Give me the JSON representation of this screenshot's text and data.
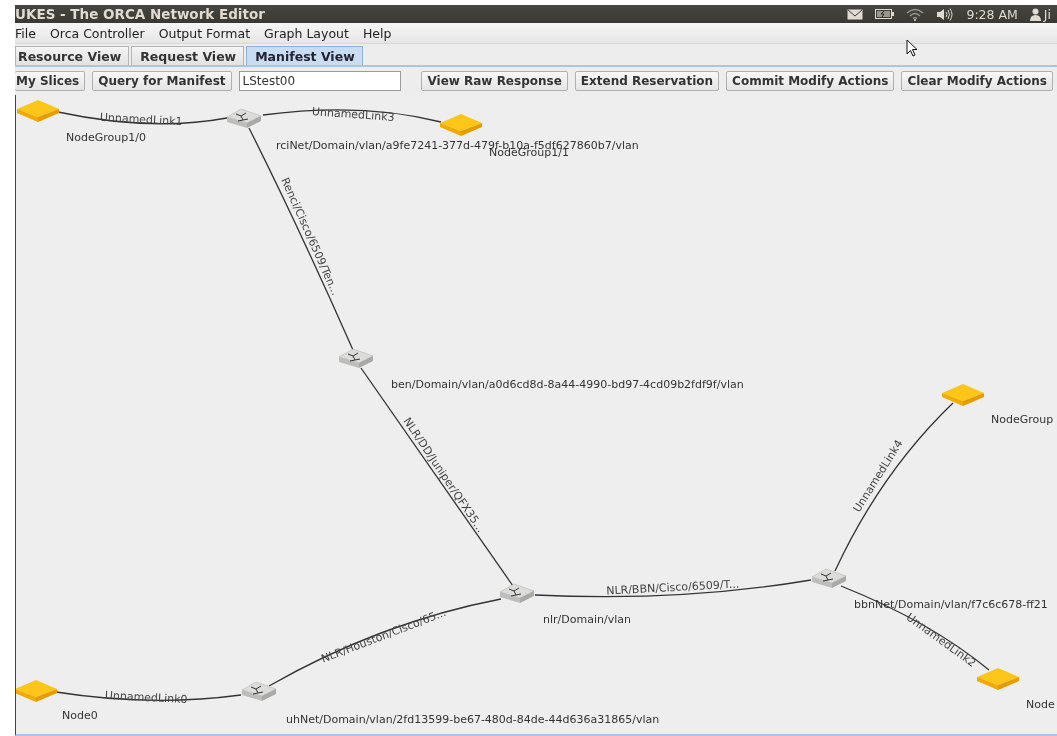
{
  "window": {
    "title": "UKES - The ORCA Network Editor"
  },
  "tray": {
    "clock": "9:28 AM",
    "user": "Ji"
  },
  "menu": [
    "File",
    "Orca Controller",
    "Output Format",
    "Graph Layout",
    "Help"
  ],
  "tabs": [
    {
      "label": "Resource View",
      "selected": false
    },
    {
      "label": "Request View",
      "selected": false
    },
    {
      "label": "Manifest View",
      "selected": true
    }
  ],
  "toolbar": {
    "left_buttons": [
      "My Slices",
      "Query for Manifest"
    ],
    "slice_field": {
      "value": "LStest00"
    },
    "right_buttons": [
      "View Raw Response",
      "Extend Reservation",
      "Commit Modify Actions",
      "Clear Modify Actions"
    ]
  },
  "graph": {
    "nodes": [
      {
        "kind": "compute",
        "label": "NodeGroup1/0"
      },
      {
        "kind": "switch",
        "label": "rciNet/Domain/vlan/a9fe7241-377d-479f-b10a-f5df627860b7/vlan"
      },
      {
        "kind": "compute",
        "label": "NodeGroup1/1"
      },
      {
        "kind": "switch",
        "label": "ben/Domain/vlan/a0d6cd8d-8a44-4990-bd97-4cd09b2fdf9f/vlan"
      },
      {
        "kind": "compute",
        "label": "NodeGroup"
      },
      {
        "kind": "switch",
        "label": "bbnNet/Domain/vlan/f7c6c678-ff21"
      },
      {
        "kind": "switch",
        "label": "nlr/Domain/vlan"
      },
      {
        "kind": "compute",
        "label": "Node"
      },
      {
        "kind": "compute",
        "label": "Node0"
      },
      {
        "kind": "switch",
        "label": "uhNet/Domain/vlan/2fd13599-be67-480d-84de-44d636a31865/vlan"
      }
    ],
    "links": [
      {
        "label": "UnnamedLink1"
      },
      {
        "label": "UnnamedLink3"
      },
      {
        "label": "Renci/Cisco/6509/Ten..."
      },
      {
        "label": "NLR/DD/Juniper/QFX35..."
      },
      {
        "label": "NLR/BBN/Cisco/6509/T..."
      },
      {
        "label": "NLR/Houston/Cisco/65..."
      },
      {
        "label": "UnnamedLink0"
      },
      {
        "label": "UnnamedLink4"
      },
      {
        "label": "UnnamedLink2"
      }
    ]
  }
}
